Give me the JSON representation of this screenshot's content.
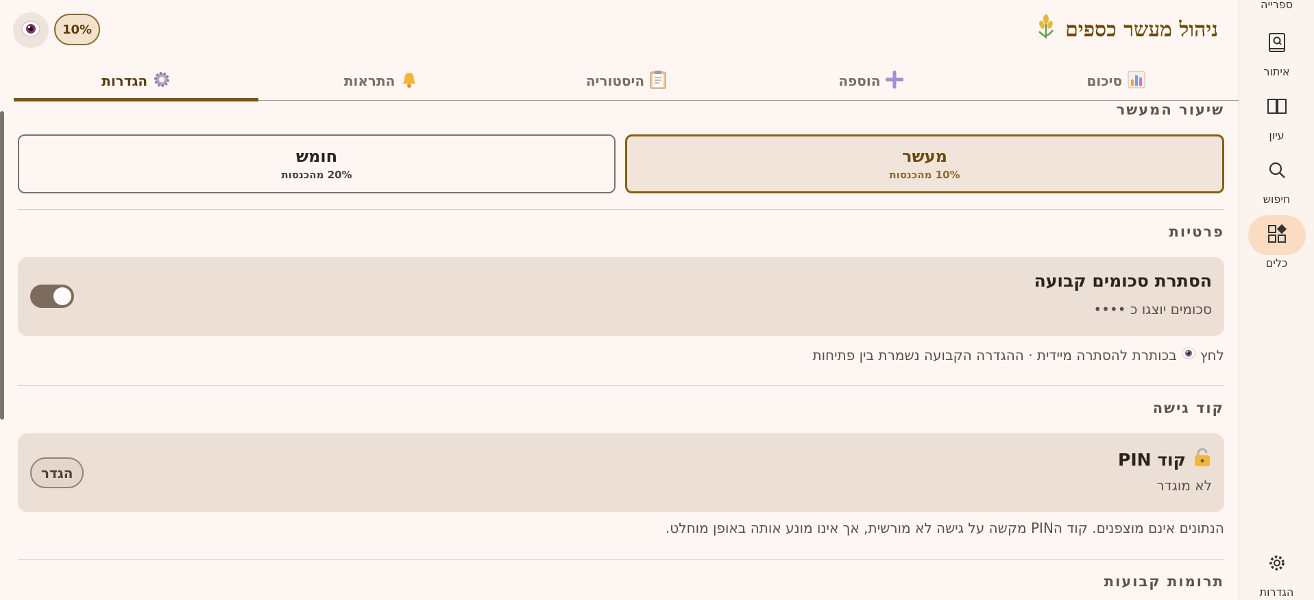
{
  "app": {
    "title": "ניהול מעשר כספים",
    "percent_chip": "10%"
  },
  "rail": {
    "top_label": "ספרייה",
    "items": [
      {
        "label": "איתור",
        "icon": "book-search-icon"
      },
      {
        "label": "עיון",
        "icon": "open-book-icon"
      },
      {
        "label": "חיפוש",
        "icon": "search-icon"
      },
      {
        "label": "כלים",
        "icon": "tools-grid-icon",
        "active": true
      }
    ],
    "settings_label": "הגדרות"
  },
  "tabs": [
    {
      "label": "סיכום",
      "icon": "bar-chart-icon",
      "active": false
    },
    {
      "label": "הוספה",
      "icon": "plus-icon",
      "active": false
    },
    {
      "label": "היסטוריה",
      "icon": "clipboard-icon",
      "active": false
    },
    {
      "label": "התראות",
      "icon": "bell-icon",
      "active": false
    },
    {
      "label": "הגדרות",
      "icon": "gear-icon",
      "active": true
    }
  ],
  "rate_section": {
    "heading": "שיעור המעשר",
    "options": [
      {
        "title": "מעשר",
        "subtitle": "10% מהכנסות",
        "selected": true
      },
      {
        "title": "חומש",
        "subtitle": "20% מהכנסות",
        "selected": false
      }
    ]
  },
  "privacy_section": {
    "heading": "פרטיות",
    "card_title": "הסתרת סכומים קבועה",
    "card_subtitle": "סכומים יוצגו כ ••••",
    "toggle_on": true,
    "note_prefix": "לחץ",
    "note_suffix": "בכותרת להסתרה מיידית · ההגדרה הקבועה נשמרת בין פתיחות"
  },
  "access_section": {
    "heading": "קוד גישה",
    "card_title": "קוד PIN",
    "card_subtitle": "לא מוגדר",
    "set_button": "הגדר",
    "note": "הנתונים אינם מוצפנים. קוד הPIN מקשה על גישה לא מורשית, אך אינו מונע אותה באופן מוחלט."
  },
  "donations_section": {
    "heading": "תרומות קבועות"
  },
  "colors": {
    "accent": "#7a5515",
    "card": "#ece0d6",
    "background": "#fdf6f2"
  }
}
